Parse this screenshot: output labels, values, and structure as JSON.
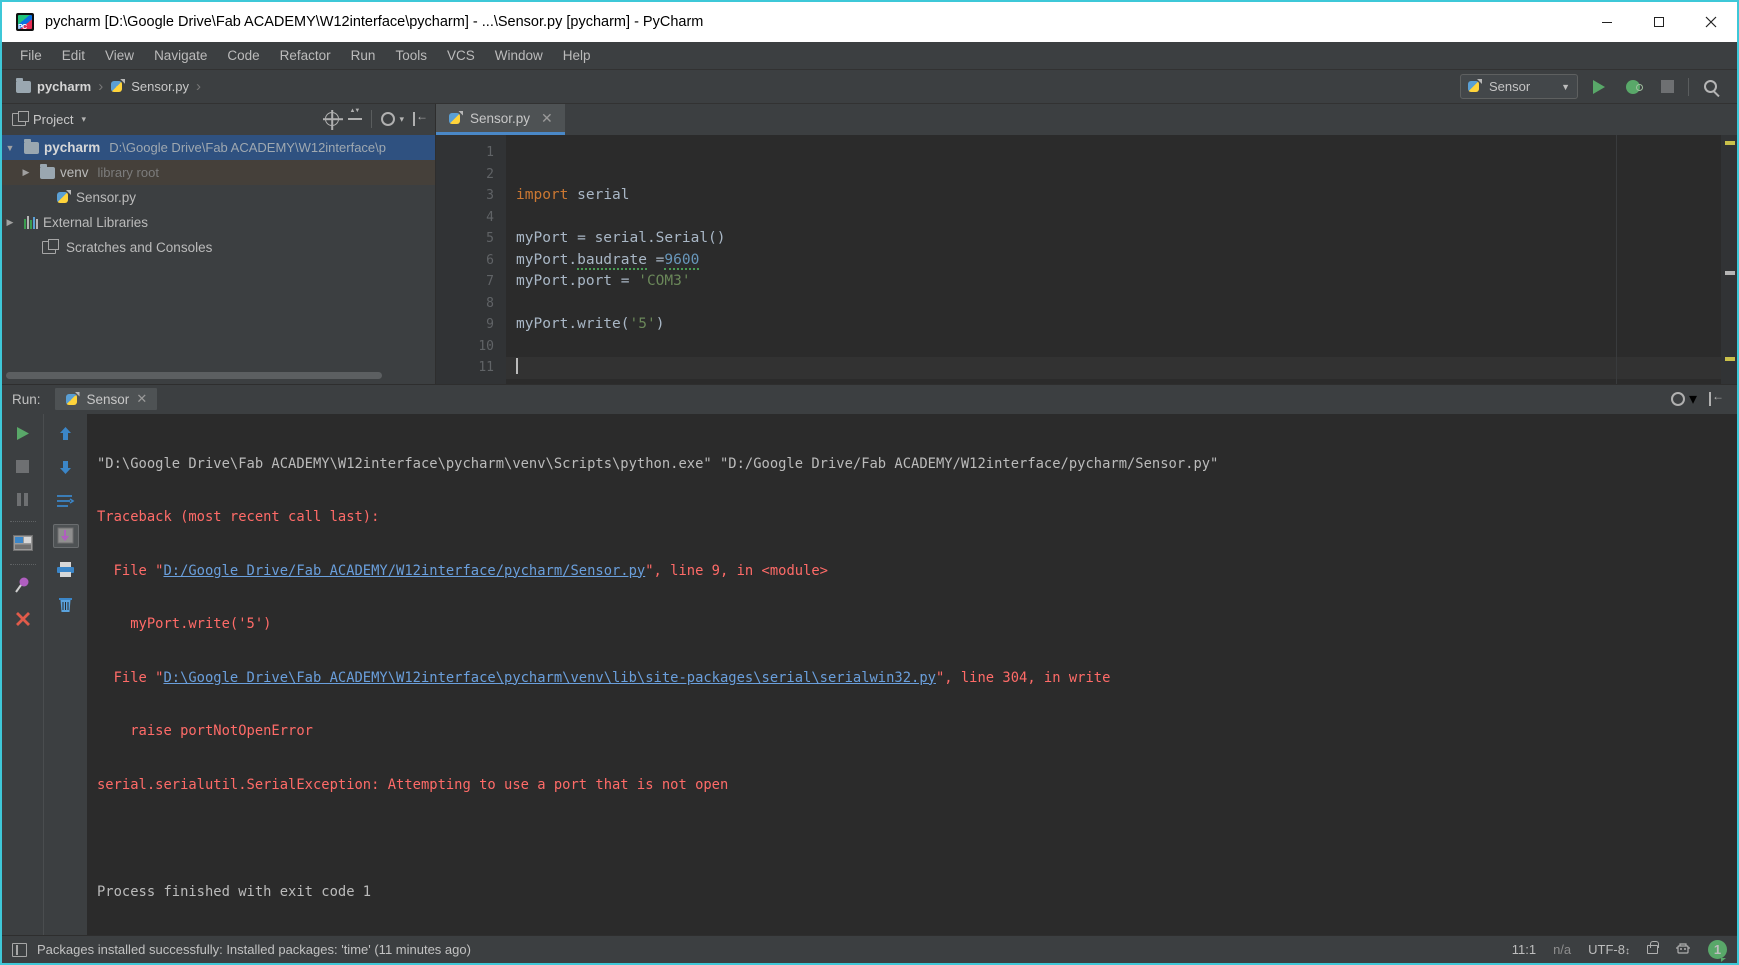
{
  "window": {
    "title": "pycharm [D:\\Google Drive\\Fab ACADEMY\\W12interface\\pycharm] - ...\\Sensor.py [pycharm] - PyCharm",
    "app_icon": "pycharm-logo-icon",
    "minimize_label": "─",
    "maximize_label": "☐",
    "close_label": "✕"
  },
  "menu": {
    "items": [
      {
        "label": "File"
      },
      {
        "label": "Edit"
      },
      {
        "label": "View"
      },
      {
        "label": "Navigate"
      },
      {
        "label": "Code"
      },
      {
        "label": "Refactor"
      },
      {
        "label": "Run"
      },
      {
        "label": "Tools"
      },
      {
        "label": "VCS"
      },
      {
        "label": "Window"
      },
      {
        "label": "Help"
      }
    ]
  },
  "breadcrumb": {
    "items": [
      {
        "label": "pycharm",
        "icon": "folder-icon"
      },
      {
        "label": "Sensor.py",
        "icon": "python-file-icon"
      }
    ],
    "separator": "›"
  },
  "toolbar": {
    "run_config_name": "Sensor",
    "run_config_caret": "▼",
    "run_button": "run-icon",
    "debug_button": "debug-icon",
    "stop_button": "stop-icon",
    "search_button": "search-everywhere-icon"
  },
  "project_panel": {
    "title": "Project",
    "caret": "▾",
    "toolbar_icons": [
      "select-opened-file-icon",
      "collapse-all-icon",
      "settings-gear-icon",
      "hide-panel-icon"
    ],
    "tree": [
      {
        "arrow": "▼",
        "label": "pycharm",
        "path": "D:\\Google Drive\\Fab ACADEMY\\W12interface\\p",
        "icon": "folder-icon",
        "state": "selected",
        "indent": 0
      },
      {
        "arrow": "▶",
        "label": "venv",
        "path": "library root",
        "icon": "venv-folder-icon",
        "state": "hovered",
        "indent": 1
      },
      {
        "arrow": "",
        "label": "Sensor.py",
        "path": "",
        "icon": "python-file-icon",
        "state": "normal",
        "indent": 2
      },
      {
        "arrow": "▶",
        "label": "External Libraries",
        "path": "",
        "icon": "libraries-icon",
        "state": "normal",
        "indent": 0
      },
      {
        "arrow": "",
        "label": "Scratches and Consoles",
        "path": "",
        "icon": "scratches-icon",
        "state": "normal",
        "indent": 1
      }
    ]
  },
  "editor": {
    "tab": {
      "label": "Sensor.py",
      "icon": "python-file-icon",
      "close": "✕"
    },
    "line_numbers": [
      "1",
      "2",
      "3",
      "4",
      "5",
      "6",
      "7",
      "8",
      "9",
      "10",
      "11"
    ],
    "caret_position": "11:1",
    "lines": [
      {
        "n": 1,
        "text": ""
      },
      {
        "n": 2,
        "text": ""
      },
      {
        "n": 3,
        "text": "import serial"
      },
      {
        "n": 4,
        "text": ""
      },
      {
        "n": 5,
        "text": "myPort = serial.Serial()"
      },
      {
        "n": 6,
        "text": "myPort.baudrate =9600"
      },
      {
        "n": 7,
        "text": "myPort.port = 'COM3'"
      },
      {
        "n": 8,
        "text": ""
      },
      {
        "n": 9,
        "text": "myPort.write('5')"
      },
      {
        "n": 10,
        "text": ""
      },
      {
        "n": 11,
        "text": ""
      }
    ]
  },
  "run_window": {
    "label": "Run:",
    "tab_label": "Sensor",
    "tab_close": "✕",
    "left_buttons": [
      "rerun-icon",
      "stop-icon",
      "pause-icon",
      "restore-layout-icon",
      "pin-tab-icon",
      "close-icon"
    ],
    "right_buttons": [
      "scroll-up-icon",
      "scroll-down-icon",
      "soft-wrap-icon",
      "scroll-to-end-icon",
      "print-icon",
      "clear-all-icon"
    ],
    "header_buttons": [
      "settings-gear-icon",
      "hide-panel-icon"
    ],
    "console": [
      {
        "type": "white",
        "text": "\"D:\\Google Drive\\Fab ACADEMY\\W12interface\\pycharm\\venv\\Scripts\\python.exe\" \"D:/Google Drive/Fab ACADEMY/W12interface/pycharm/Sensor.py\""
      },
      {
        "type": "error",
        "text": "Traceback (most recent call last):"
      },
      {
        "type": "mixed",
        "pre": "  File \"",
        "link": "D:/Google Drive/Fab ACADEMY/W12interface/pycharm/Sensor.py",
        "post": "\", line 9, in <module>"
      },
      {
        "type": "error",
        "text": "    myPort.write('5')"
      },
      {
        "type": "mixed",
        "pre": "  File \"",
        "link": "D:\\Google Drive\\Fab ACADEMY\\W12interface\\pycharm\\venv\\lib\\site-packages\\serial\\serialwin32.py",
        "post": "\", line 304, in write"
      },
      {
        "type": "error",
        "text": "    raise portNotOpenError"
      },
      {
        "type": "error",
        "text": "serial.serialutil.SerialException: Attempting to use a port that is not open"
      },
      {
        "type": "blank",
        "text": ""
      },
      {
        "type": "white",
        "text": "Process finished with exit code 1"
      }
    ]
  },
  "statusbar": {
    "message": "Packages installed successfully: Installed packages: 'time' (11 minutes ago)",
    "position": "11:1",
    "line_separator": "n/a",
    "encoding": "UTF-8",
    "encoding_caret": "↕",
    "lock_icon": "read-only-toggle-icon",
    "inspection_icon": "inspection-profile-icon",
    "notification_count": "1"
  },
  "colors": {
    "accent_blue": "#4a88c7",
    "selection_blue": "#2f5180",
    "green_run": "#59a869",
    "error_red": "#ff6b68",
    "link_blue": "#6a9fdc",
    "keyword_orange": "#cc7832",
    "string_green": "#6a8759",
    "number_blue": "#6897bb",
    "panel_bg": "#3c3f41",
    "editor_bg": "#2b2b2b",
    "window_border": "#3ec8d8"
  }
}
